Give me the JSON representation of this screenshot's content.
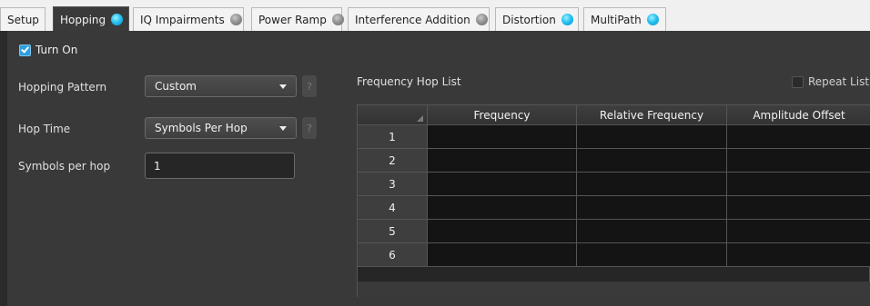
{
  "tabs": [
    {
      "label": "Setup",
      "indicator": "none",
      "active": false
    },
    {
      "label": "Hopping",
      "indicator": "on",
      "active": true
    },
    {
      "label": "IQ Impairments",
      "indicator": "off",
      "active": false
    },
    {
      "label": "Power Ramp",
      "indicator": "off",
      "active": false
    },
    {
      "label": "Interference Addition",
      "indicator": "off",
      "active": false
    },
    {
      "label": "Distortion",
      "indicator": "on",
      "active": false
    },
    {
      "label": "MultiPath",
      "indicator": "on",
      "active": false
    }
  ],
  "hopping": {
    "turn_on_label": "Turn On",
    "turn_on_checked": true,
    "pattern_label": "Hopping Pattern",
    "pattern_value": "Custom",
    "hop_time_label": "Hop Time",
    "hop_time_value": "Symbols Per Hop",
    "symbols_label": "Symbols per hop",
    "symbols_value": "1",
    "help_glyph": "?"
  },
  "hop_list": {
    "title": "Frequency Hop List",
    "repeat_label": "Repeat List",
    "repeat_checked": false,
    "columns": [
      "Frequency",
      "Relative Frequency",
      "Amplitude Offset"
    ],
    "rows": [
      "1",
      "2",
      "3",
      "4",
      "5",
      "6"
    ]
  },
  "colors": {
    "indicator_on": "#26c2f0",
    "indicator_off": "#8f8f8f",
    "panel_bg": "#393939",
    "cell_bg": "#141414"
  }
}
